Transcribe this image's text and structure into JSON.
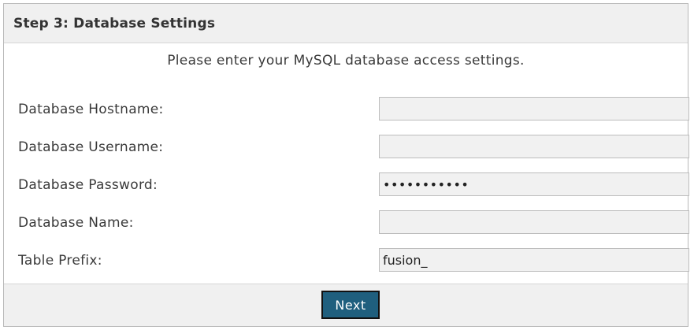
{
  "panel": {
    "title": "Step 3: Database Settings",
    "intro": "Please enter your MySQL database access settings."
  },
  "fields": [
    {
      "label": "Database Hostname:",
      "value": "",
      "type": "text"
    },
    {
      "label": "Database Username:",
      "value": "",
      "type": "text"
    },
    {
      "label": "Database Password:",
      "value": "•••••••••••",
      "type": "password"
    },
    {
      "label": "Database Name:",
      "value": "",
      "type": "text"
    },
    {
      "label": "Table Prefix:",
      "value": "fusion_",
      "type": "text"
    }
  ],
  "footer": {
    "next_label": "Next"
  },
  "colors": {
    "header_background": "#f0f0f0",
    "button_background": "#1f5f7e",
    "input_background": "#f1f1f1"
  }
}
